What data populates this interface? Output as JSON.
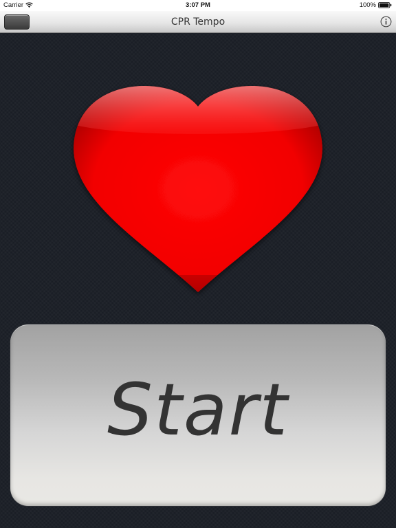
{
  "status_bar": {
    "carrier": "Carrier",
    "time": "3:07 PM",
    "battery_percent": "100%",
    "battery_level": 1.0
  },
  "nav_bar": {
    "title": "CPR Tempo",
    "left_button": "dark-rounded-button",
    "right_icon": "info-icon"
  },
  "main": {
    "heart_icon": "heart-icon",
    "start_label": "Start"
  },
  "colors": {
    "background": "#1b1f27",
    "heart_red": "#ff1a1a",
    "start_text": "#333333"
  }
}
